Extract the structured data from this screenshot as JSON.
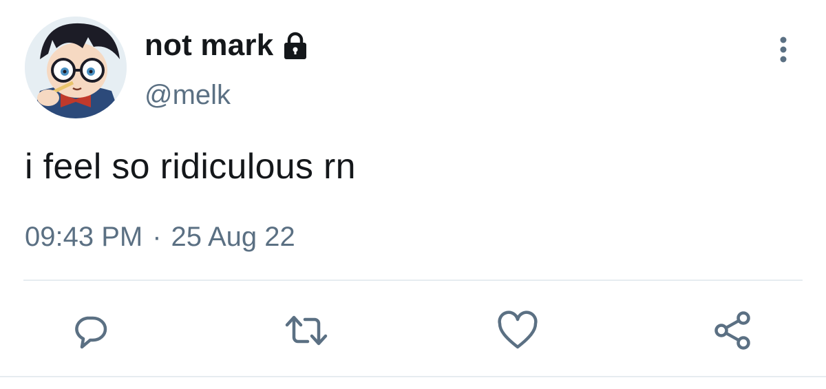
{
  "tweet": {
    "display_name": "not mark",
    "handle": "@melk",
    "text": "i feel so ridiculous rn",
    "time": "09:43 PM",
    "separator": "·",
    "date": "25 Aug 22"
  },
  "icons": {
    "protected": "lock-icon",
    "more": "more-vertical-icon",
    "reply": "reply-icon",
    "retweet": "retweet-icon",
    "like": "heart-icon",
    "share": "share-icon"
  },
  "colors": {
    "text": "#14171a",
    "secondary": "#5b7083",
    "divider": "#e6ecf0"
  }
}
